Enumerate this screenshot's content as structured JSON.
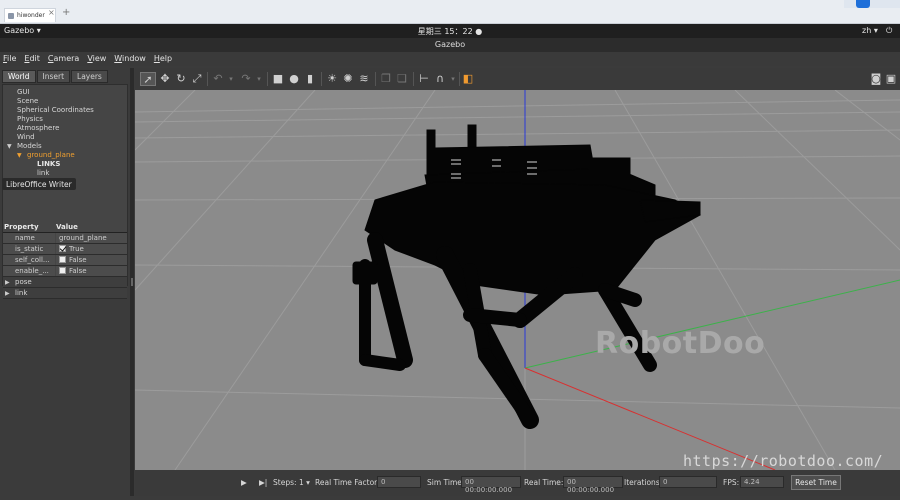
{
  "browser": {
    "tab_label": "hiwonder",
    "corner_text": ""
  },
  "topbar": {
    "app_menu": "Gazebo ▾",
    "clock": "星期三 15：22 ●",
    "lang": "zh ▾",
    "sys_icon": "⏻"
  },
  "window": {
    "title": "Gazebo"
  },
  "menu": [
    {
      "label_u": "F",
      "label_rest": "ile"
    },
    {
      "label_u": "E",
      "label_rest": "dit"
    },
    {
      "label_u": "C",
      "label_rest": "amera"
    },
    {
      "label_u": "V",
      "label_rest": "iew"
    },
    {
      "label_u": "W",
      "label_rest": "indow"
    },
    {
      "label_u": "H",
      "label_rest": "elp"
    }
  ],
  "panel": {
    "tabs": [
      "World",
      "Insert",
      "Layers"
    ],
    "tree": [
      "GUI",
      "Scene",
      "Spherical Coordinates",
      "Physics",
      "Atmosphere",
      "Wind",
      "Models",
      "ground_plane",
      "LINKS",
      "link"
    ],
    "tooltip": "LibreOffice Writer",
    "props_header": {
      "property": "Property",
      "value": "Value"
    },
    "props": [
      {
        "key": "name",
        "value": "ground_plane"
      },
      {
        "key": "is_static",
        "value": "True",
        "checked": true
      },
      {
        "key": "self_coll...",
        "value": "False",
        "checked": false
      },
      {
        "key": "enable_...",
        "value": "False",
        "checked": false
      }
    ],
    "groups": [
      "pose",
      "link"
    ]
  },
  "toolbar_icons": [
    "select-arrow-icon",
    "translate-icon",
    "rotate-icon",
    "scale-icon",
    "undo-icon",
    "redo-icon",
    "box-icon",
    "sphere-icon",
    "cylinder-icon",
    "point-light-icon",
    "spot-light-icon",
    "directional-light-icon",
    "copy-icon",
    "paste-icon",
    "align-icon",
    "snap-icon",
    "change-view-icon",
    "screenshot-icon",
    "record-icon"
  ],
  "watermark": "RobotDoo",
  "url_watermark": "https://robotdoo.com/",
  "bottom": {
    "play_icon": "▶",
    "step_icon": "▶|",
    "steps_label": "Steps:",
    "steps_value": "1 ▾",
    "rtf_label": "Real Time Factor:",
    "rtf_value": "0",
    "sim_label": "Sim Time:",
    "sim_value": "00 00:00:00.000",
    "real_label": "Real Time:",
    "real_value": "00 00:00:00.000",
    "iter_label": "Iterations:",
    "iter_value": "0",
    "fps_label": "FPS:",
    "fps_value": "4.24",
    "reset_label": "Reset Time"
  }
}
